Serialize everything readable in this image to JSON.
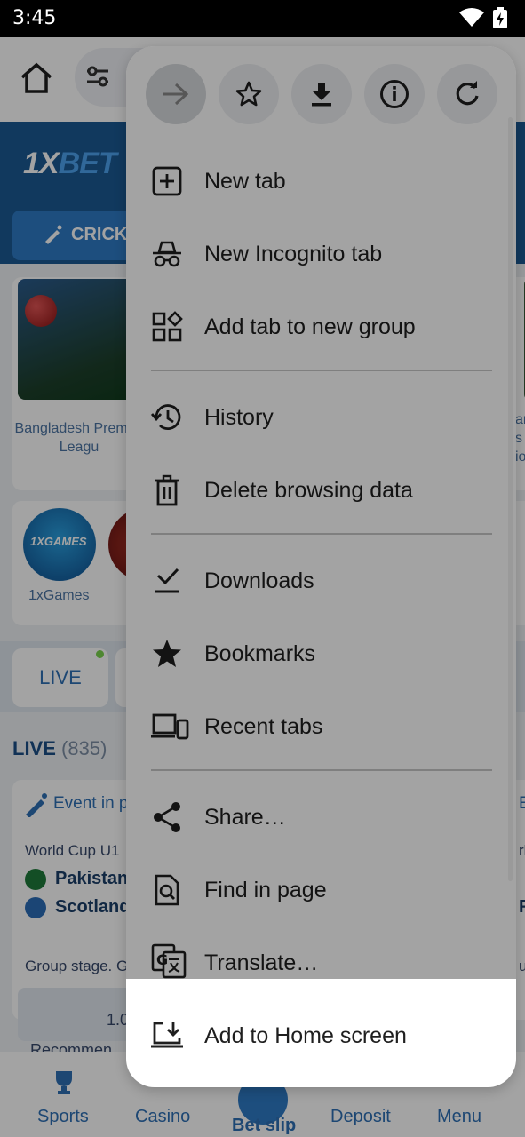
{
  "status_bar": {
    "time": "3:45",
    "icons": [
      "wifi-icon",
      "battery-charging-icon"
    ]
  },
  "page": {
    "logo_prefix": "1X",
    "logo_suffix": "BET",
    "sport_chip": "CRICK",
    "card_label": "Bangladesh Premier Leagu",
    "right_card_fragments": [
      "ar",
      "s",
      "io"
    ],
    "games_circle_text": "1XGAMES",
    "games_label": "1xGames",
    "live_chip": "LIVE",
    "live_heading": "LIVE",
    "live_count": "(835)",
    "event_title": "Event in p",
    "event_title_right": "E",
    "event_sub": "World Cup U1",
    "event_sub_right": "rl",
    "team1": "Pakistan",
    "team1_right": "",
    "team2": "Scotland",
    "team2_right": "F",
    "stage": "Group stage. G",
    "stage_right": "u",
    "odd_value": "1.0",
    "recommend": "Recommen",
    "nav": {
      "sports": "Sports",
      "casino": "Casino",
      "betslip": "Bet slip",
      "deposit": "Deposit",
      "menu": "Menu"
    }
  },
  "menu": {
    "top_icons": [
      "forward-icon",
      "bookmark-star-icon",
      "download-icon",
      "info-icon",
      "refresh-icon"
    ],
    "items": [
      {
        "label": "New tab",
        "icon": "new-tab-icon"
      },
      {
        "label": "New Incognito tab",
        "icon": "incognito-icon"
      },
      {
        "label": "Add tab to new group",
        "icon": "tab-group-icon"
      },
      {
        "label": "History",
        "icon": "history-icon"
      },
      {
        "label": "Delete browsing data",
        "icon": "trash-icon"
      },
      {
        "label": "Downloads",
        "icon": "downloads-check-icon"
      },
      {
        "label": "Bookmarks",
        "icon": "star-filled-icon"
      },
      {
        "label": "Recent tabs",
        "icon": "devices-icon"
      },
      {
        "label": "Share…",
        "icon": "share-icon"
      },
      {
        "label": "Find in page",
        "icon": "find-in-page-icon"
      },
      {
        "label": "Translate…",
        "icon": "translate-icon"
      },
      {
        "label": "Add to Home screen",
        "icon": "add-to-home-icon"
      }
    ]
  }
}
